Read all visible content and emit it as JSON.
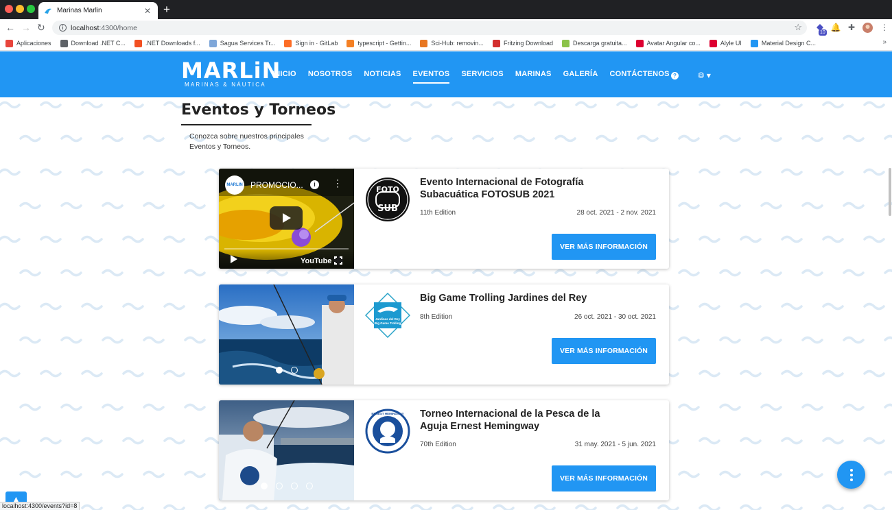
{
  "browser": {
    "tab_title": "Marinas Marlin",
    "url_host": "localhost",
    "url_rest": ":4300/home",
    "extension_badge": "10",
    "bookmarks": [
      {
        "label": "Aplicaciones",
        "color": "#e8453c"
      },
      {
        "label": "Download .NET C...",
        "color": "#5f6368"
      },
      {
        "label": ".NET Downloads f...",
        "color": "#f25022"
      },
      {
        "label": "Sagua Services Tr...",
        "color": "#7fa7d9"
      },
      {
        "label": "Sign in · GitLab",
        "color": "#fc6d26"
      },
      {
        "label": "typescript - Gettin...",
        "color": "#f48024"
      },
      {
        "label": "Sci-Hub: removin...",
        "color": "#e87722"
      },
      {
        "label": "Fritzing Download",
        "color": "#d32f2f"
      },
      {
        "label": "Descarga gratuita...",
        "color": "#8bc34a"
      },
      {
        "label": "Avatar Angular co...",
        "color": "#dd0031"
      },
      {
        "label": "Alyle UI",
        "color": "#dd0031"
      },
      {
        "label": "Material Design C...",
        "color": "#2196f3"
      }
    ]
  },
  "brand": {
    "name": "MARLiN",
    "tagline": "MARINAS & NÁUTICA",
    "accent": "#2196f3"
  },
  "menu": [
    {
      "label": "INICIO",
      "active": false
    },
    {
      "label": "NOSOTROS",
      "active": false
    },
    {
      "label": "NOTICIAS",
      "active": false
    },
    {
      "label": "EVENTOS",
      "active": true
    },
    {
      "label": "SERVICIOS",
      "active": false
    },
    {
      "label": "MARINAS",
      "active": false
    },
    {
      "label": "GALERÍA",
      "active": false
    },
    {
      "label": "CONTÁCTENOS",
      "active": false
    }
  ],
  "section": {
    "title": "Eventos y Torneos",
    "description": "Conozca sobre nuestros principales Eventos y Torneos."
  },
  "video": {
    "channel": "MARLIN",
    "title": "PROMOCIO...",
    "brand": "YouTube"
  },
  "events": [
    {
      "title": "Evento Internacional de Fotografía Subacuática FOTOSUB 2021",
      "edition": "11th Edition",
      "dates": "28 oct. 2021 - 2 nov. 2021",
      "button": "VER MÁS INFORMACIÓN",
      "logo_text_1": "FOTO",
      "logo_text_2": "SUB"
    },
    {
      "title": "Big Game Trolling Jardines del Rey",
      "edition": "8th Edition",
      "dates": "26 oct. 2021 - 30 oct. 2021",
      "button": "VER MÁS INFORMACIÓN",
      "logo_text_1": "Jardines del Rey",
      "logo_text_2": "Big Game Trolling"
    },
    {
      "title": "Torneo Internacional de la Pesca de la Aguja Ernest Hemingway",
      "edition": "70th Edition",
      "dates": "31 may. 2021 - 5 jun. 2021",
      "button": "VER MÁS INFORMACIÓN",
      "logo_text_1": "ERNEST HEMINGWAY"
    }
  ],
  "status_url": "localhost:4300/events?id=8"
}
